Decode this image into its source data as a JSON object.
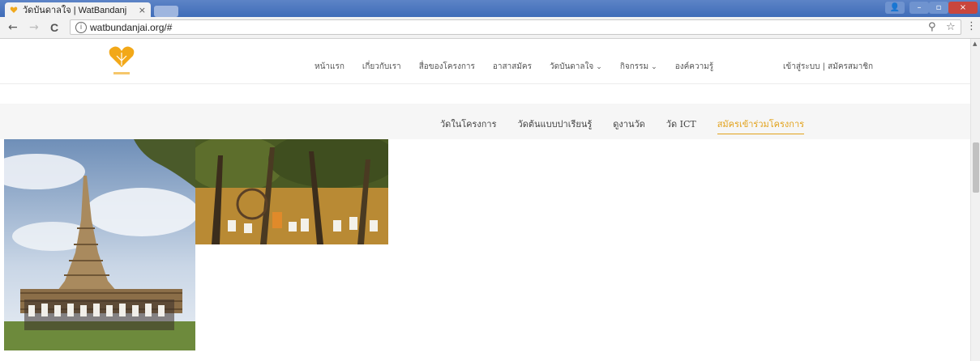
{
  "browser": {
    "tab_title": "วัดบันดาลใจ | WatBandanj",
    "tab_close": "×",
    "back": "←",
    "forward": "→",
    "reload": "C",
    "info": "i",
    "url": "watbundanjai.org/#",
    "zoom_icon": "⚲",
    "star_icon": "☆",
    "menu_icon": "⋮",
    "window_controls": {
      "user": "👤",
      "minimize": "–",
      "maximize": "▫",
      "close": "×"
    }
  },
  "site": {
    "accent_color": "#e2a21b",
    "main_nav": [
      {
        "label": "หน้าแรก"
      },
      {
        "label": "เกี่ยวกับเรา"
      },
      {
        "label": "สื่อของโครงการ"
      },
      {
        "label": "อาสาสมัคร"
      },
      {
        "label": "วัดบันดาลใจ",
        "dropdown": true
      },
      {
        "label": "กิจกรรม",
        "dropdown": true
      },
      {
        "label": "องค์ความรู้"
      }
    ],
    "login": "เข้าสู่ระบบ | สมัครสมาชิก",
    "sub_nav": [
      {
        "label": "วัดในโครงการ",
        "active": false
      },
      {
        "label": "วัดต้นแบบปาเรียนรู้",
        "active": false
      },
      {
        "label": "ดูงานวัด",
        "active": false
      },
      {
        "label": "วัด ICT",
        "active": false
      },
      {
        "label": "สมัครเข้าร่วมโครงการ",
        "active": true
      }
    ]
  }
}
